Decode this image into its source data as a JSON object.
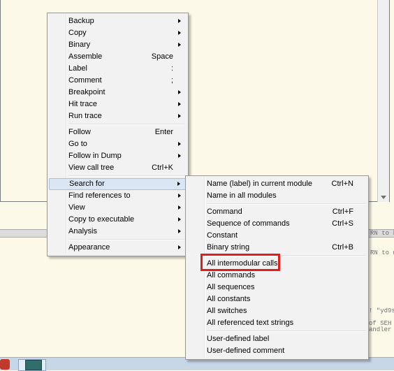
{
  "background": {
    "fragments": [
      "RN to k",
      "RN to n",
      "! \"yd9s",
      "of SEH",
      "andler"
    ]
  },
  "context_menu": {
    "groups": [
      [
        {
          "label": "Backup",
          "shortcut": "",
          "submenu": true
        },
        {
          "label": "Copy",
          "shortcut": "",
          "submenu": true
        },
        {
          "label": "Binary",
          "shortcut": "",
          "submenu": true
        },
        {
          "label": "Assemble",
          "shortcut": "Space",
          "submenu": false
        },
        {
          "label": "Label",
          "shortcut": ":",
          "submenu": false
        },
        {
          "label": "Comment",
          "shortcut": ";",
          "submenu": false
        },
        {
          "label": "Breakpoint",
          "shortcut": "",
          "submenu": true
        },
        {
          "label": "Hit trace",
          "shortcut": "",
          "submenu": true
        },
        {
          "label": "Run trace",
          "shortcut": "",
          "submenu": true
        }
      ],
      [
        {
          "label": "Follow",
          "shortcut": "Enter",
          "submenu": false
        },
        {
          "label": "Go to",
          "shortcut": "",
          "submenu": true
        },
        {
          "label": "Follow in Dump",
          "shortcut": "",
          "submenu": true
        },
        {
          "label": "View call tree",
          "shortcut": "Ctrl+K",
          "submenu": false
        }
      ],
      [
        {
          "label": "Search for",
          "shortcut": "",
          "submenu": true,
          "highlighted": true
        },
        {
          "label": "Find references to",
          "shortcut": "",
          "submenu": true
        },
        {
          "label": "View",
          "shortcut": "",
          "submenu": true
        },
        {
          "label": "Copy to executable",
          "shortcut": "",
          "submenu": true
        },
        {
          "label": "Analysis",
          "shortcut": "",
          "submenu": true
        }
      ],
      [
        {
          "label": "Appearance",
          "shortcut": "",
          "submenu": true
        }
      ]
    ]
  },
  "search_submenu": {
    "groups": [
      [
        {
          "label": "Name (label) in current module",
          "shortcut": "Ctrl+N"
        },
        {
          "label": "Name in all modules",
          "shortcut": ""
        }
      ],
      [
        {
          "label": "Command",
          "shortcut": "Ctrl+F"
        },
        {
          "label": "Sequence of commands",
          "shortcut": "Ctrl+S"
        },
        {
          "label": "Constant",
          "shortcut": ""
        },
        {
          "label": "Binary string",
          "shortcut": "Ctrl+B"
        }
      ],
      [
        {
          "label": "All intermodular calls",
          "shortcut": "",
          "marked": true
        },
        {
          "label": "All commands",
          "shortcut": ""
        },
        {
          "label": "All sequences",
          "shortcut": ""
        },
        {
          "label": "All constants",
          "shortcut": ""
        },
        {
          "label": "All switches",
          "shortcut": ""
        },
        {
          "label": "All referenced text strings",
          "shortcut": ""
        }
      ],
      [
        {
          "label": "User-defined label",
          "shortcut": ""
        },
        {
          "label": "User-defined comment",
          "shortcut": ""
        }
      ]
    ]
  },
  "colors": {
    "highlight": "#dbe6f4",
    "annotation_box": "#e31b1b",
    "pane_background": "#fdf9e9"
  }
}
